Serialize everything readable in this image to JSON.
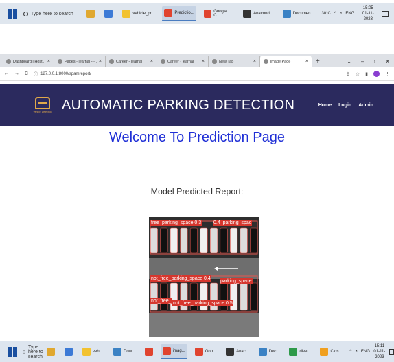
{
  "taskbar_top": {
    "search_placeholder": "Type here to search",
    "apps": [
      {
        "label": "",
        "icon": "people-icon",
        "color": "#e0a830"
      },
      {
        "label": "",
        "icon": "calculator-icon",
        "color": "#3c7ad6"
      },
      {
        "label": "vehicle_pr...",
        "icon": "folder-icon",
        "color": "#f2c230"
      },
      {
        "label": "Predictio...",
        "icon": "chrome-icon",
        "color": "#e0442f",
        "active": true
      },
      {
        "label": "Google C...",
        "icon": "chrome-icon",
        "color": "#e0442f"
      },
      {
        "label": "Anacond...",
        "icon": "terminal-icon",
        "color": "#333333"
      },
      {
        "label": "Documen...",
        "icon": "document-icon",
        "color": "#3b82c4"
      }
    ],
    "weather": "30°C",
    "lang": "ENG",
    "time": "15:05",
    "date": "01-11-2023"
  },
  "browser": {
    "tabs": [
      {
        "label": "Dashboard | Hosti...",
        "icon": "hostinger-icon"
      },
      {
        "label": "Pages - learnai --- ...",
        "icon": "wp-icon"
      },
      {
        "label": "Career - learnai",
        "icon": "page-icon"
      },
      {
        "label": "Career - learnai",
        "icon": "page-icon"
      },
      {
        "label": "New Tab",
        "icon": "globe-icon"
      },
      {
        "label": "image Page",
        "icon": "pin-icon",
        "active": true
      }
    ],
    "url": "127.0.0.1:8000/spamreport/"
  },
  "site": {
    "logo_text": "Vehicle Detection",
    "title": "AUTOMATIC PARKING DETECTION",
    "nav": {
      "home": "Home",
      "login": "Login",
      "admin": "Admin"
    }
  },
  "main": {
    "welcome": "Welcome To Prediction Page",
    "report_title": "Model Predicted Report:",
    "labels": {
      "l1": "free_parking_space 0.3",
      "l2": "0.4_parking_spac",
      "l3": "not_free_parking_space 0.4",
      "l4": "parking_space",
      "l5": "not_free_",
      "l6": "not_free_parking_space 0.5"
    }
  },
  "taskbar_bottom": {
    "search_placeholder": "Type here to search",
    "apps": [
      {
        "label": "",
        "icon": "people-icon",
        "color": "#e0a830"
      },
      {
        "label": "",
        "icon": "calculator-icon",
        "color": "#3c7ad6"
      },
      {
        "label": "vehi...",
        "icon": "folder-icon",
        "color": "#f2c230"
      },
      {
        "label": "Dow...",
        "icon": "download-icon",
        "color": "#3b82c4"
      },
      {
        "label": "",
        "icon": "chrome-icon",
        "color": "#e0442f"
      },
      {
        "label": "imag...",
        "icon": "chrome-icon",
        "color": "#e0442f",
        "active": true
      },
      {
        "label": "Goo...",
        "icon": "chrome-icon",
        "color": "#e0442f"
      },
      {
        "label": "Anac...",
        "icon": "terminal-icon",
        "color": "#333333"
      },
      {
        "label": "Doc...",
        "icon": "document-icon",
        "color": "#3b82c4"
      },
      {
        "label": "dive...",
        "icon": "chrome-icon",
        "color": "#2e9a4a"
      },
      {
        "label": "Clos...",
        "icon": "weather-icon",
        "color": "#f0a020"
      }
    ],
    "lang": "ENG",
    "time": "15:11",
    "date": "01-11-2023"
  }
}
